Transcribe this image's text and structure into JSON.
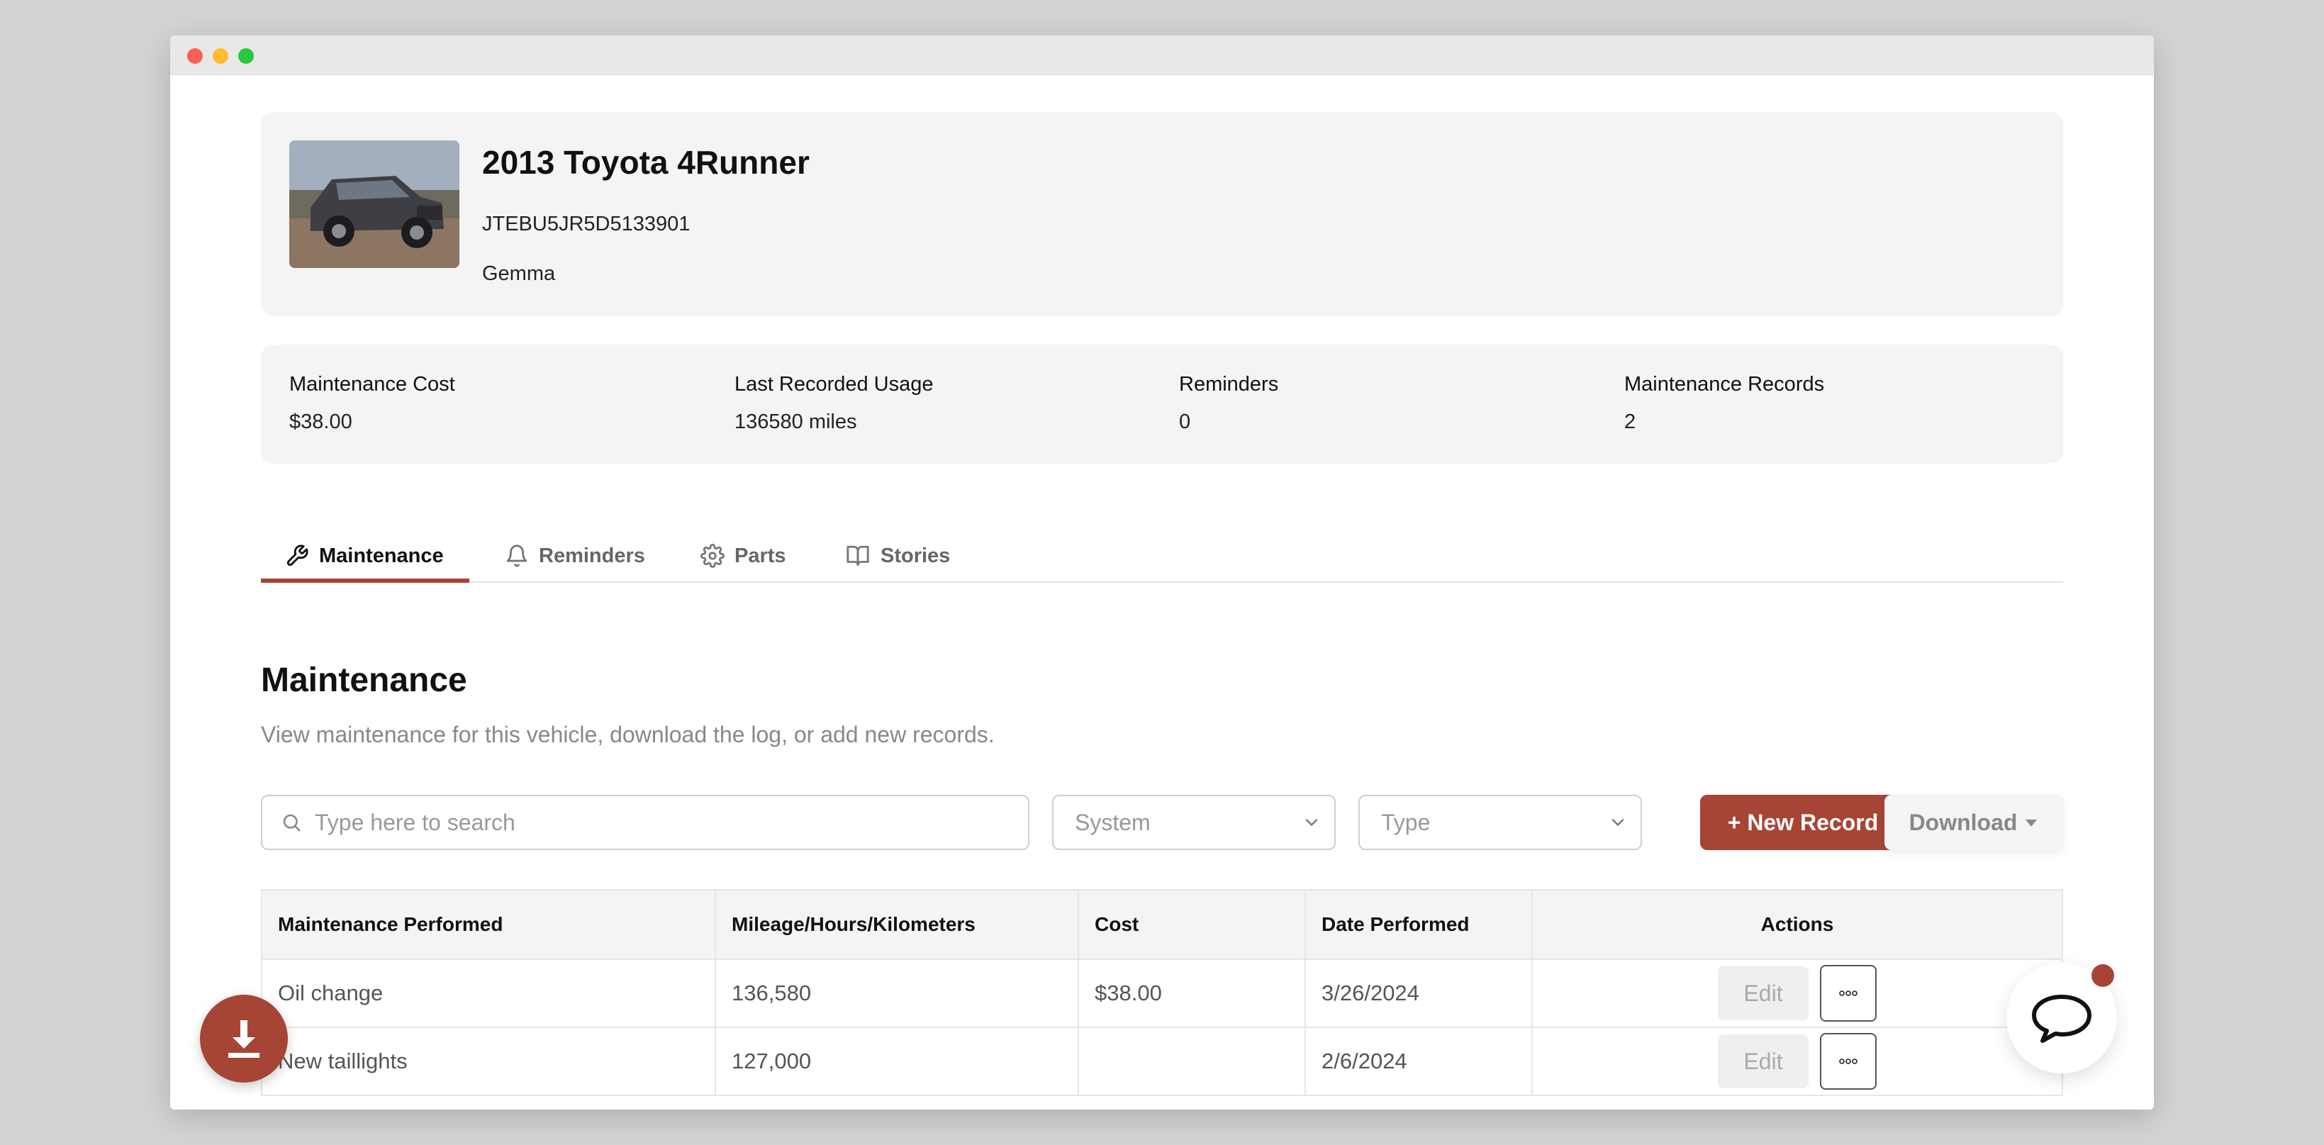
{
  "vehicle": {
    "title": "2013 Toyota 4Runner",
    "vin": "JTEBU5JR5D5133901",
    "owner": "Gemma"
  },
  "stats": [
    {
      "label": "Maintenance Cost",
      "value": "$38.00"
    },
    {
      "label": "Last Recorded Usage",
      "value": "136580 miles"
    },
    {
      "label": "Reminders",
      "value": "0"
    },
    {
      "label": "Maintenance Records",
      "value": "2"
    }
  ],
  "tabs": [
    {
      "label": "Maintenance",
      "icon": "wrench-icon",
      "active": true
    },
    {
      "label": "Reminders",
      "icon": "bell-icon",
      "active": false
    },
    {
      "label": "Parts",
      "icon": "gear-icon",
      "active": false
    },
    {
      "label": "Stories",
      "icon": "book-icon",
      "active": false
    }
  ],
  "section": {
    "title": "Maintenance",
    "description": "View maintenance for this vehicle, download the log, or add new records."
  },
  "toolbar": {
    "search_placeholder": "Type here to search",
    "system_placeholder": "System",
    "type_placeholder": "Type",
    "new_record_label": "+ New Record",
    "download_label": "Download"
  },
  "table": {
    "columns": [
      "Maintenance Performed",
      "Mileage/Hours/Kilometers",
      "Cost",
      "Date Performed",
      "Actions"
    ],
    "rows": [
      {
        "maintenance": "Oil change",
        "mileage": "136,580",
        "cost": "$38.00",
        "date": "3/26/2024"
      },
      {
        "maintenance": "New taillights",
        "mileage": "127,000",
        "cost": "",
        "date": "2/6/2024"
      }
    ],
    "edit_label": "Edit"
  },
  "colors": {
    "accent": "#a64536",
    "card_bg": "#f4f4f4"
  }
}
